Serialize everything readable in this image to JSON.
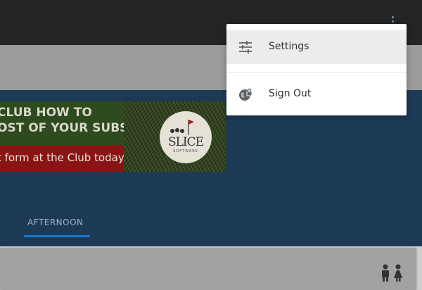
{
  "menu": {
    "items": [
      {
        "label": "Settings",
        "icon": "settings-sliders-icon"
      },
      {
        "label": "Sign Out",
        "icon": "sign-out-globe-lock-icon"
      }
    ]
  },
  "banner": {
    "line1": "CLUB HOW TO",
    "line2": "OST OF YOUR SUBS",
    "line3": "t form at the Club today",
    "logo_text": "SLICE",
    "logo_subtext": "SOFTWARE"
  },
  "tabs": [
    {
      "label": "AFTERNOON",
      "selected": true
    }
  ],
  "colors": {
    "appbar": "#222426",
    "hero": "#1c3a56",
    "tab_indicator": "#1a74c9",
    "menu_highlight": "#ececec"
  }
}
